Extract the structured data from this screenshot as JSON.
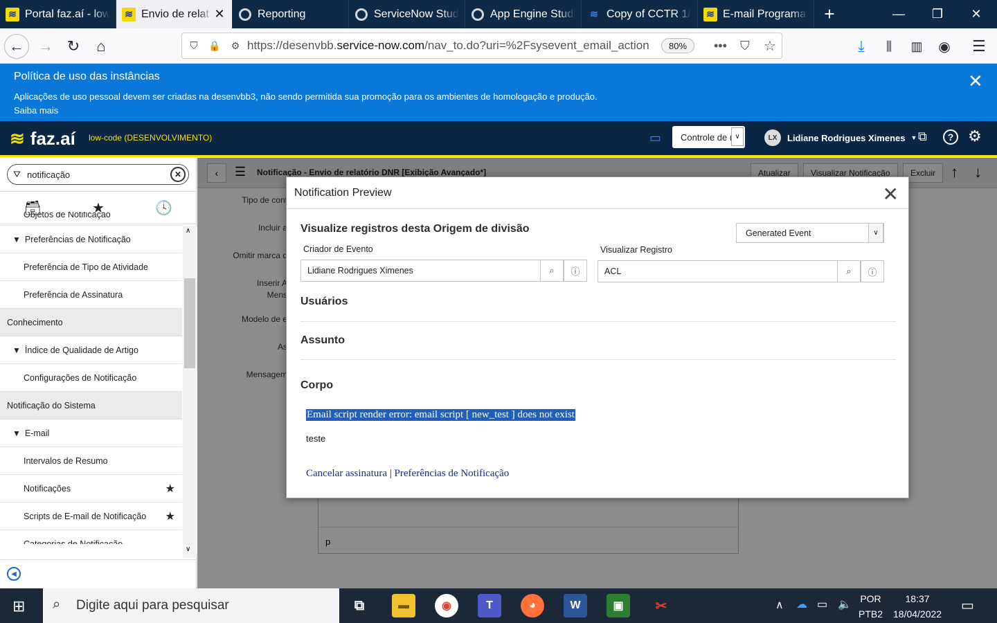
{
  "browser": {
    "tabs": [
      {
        "label": "Portal faz.aí - low",
        "icon": "faz-icon",
        "active": false
      },
      {
        "label": "Envio de relat",
        "icon": "faz-icon",
        "active": true
      },
      {
        "label": "Reporting",
        "icon": "servicenow-icon",
        "active": false
      },
      {
        "label": "ServiceNow Studi",
        "icon": "servicenow-icon",
        "active": false
      },
      {
        "label": "App Engine Studi",
        "icon": "servicenow-icon",
        "active": false
      },
      {
        "label": "Copy of CCTR 1/2",
        "icon": "bb-icon",
        "active": false
      },
      {
        "label": "E-mail Programa",
        "icon": "faz-icon",
        "active": false
      }
    ],
    "url_prefix": "https://desenvbb.",
    "url_domain": "service-now.com",
    "url_path": "/nav_to.do?uri=%2Fsysevent_email_action",
    "zoom": "80%"
  },
  "banner": {
    "title": "Política de uso das instâncias",
    "text": "Aplicações de uso pessoal devem ser criadas na desenvbb3, não sendo permitida sua promoção para os ambientes de homologação e produção.",
    "more": "Saiba mais"
  },
  "app": {
    "logo": "faz.aí",
    "subtitle": "low-code (DESENVOLVIMENTO)",
    "control_select": "Controle de (",
    "user_initials": "LX",
    "user_name": "Lidiane Rodrigues Ximenes"
  },
  "leftnav": {
    "filter": "notificação",
    "items": [
      {
        "type": "itm",
        "label": "Objetos de Notificação",
        "star": false
      },
      {
        "type": "grp",
        "label": "Preferências de Notificação",
        "star": false
      },
      {
        "type": "itm",
        "label": "Preferência de Tipo de Atividade",
        "star": false
      },
      {
        "type": "itm",
        "label": "Preferência de Assinatura",
        "star": false
      },
      {
        "type": "sec",
        "label": "Conhecimento",
        "star": false
      },
      {
        "type": "grp",
        "label": "Índice de Qualidade de Artigo",
        "star": false
      },
      {
        "type": "itm",
        "label": "Configurações de Notificação",
        "star": false
      },
      {
        "type": "sec",
        "label": "Notificação do Sistema",
        "star": false
      },
      {
        "type": "grp",
        "label": "E-mail",
        "star": false
      },
      {
        "type": "itm",
        "label": "Intervalos de Resumo",
        "star": false
      },
      {
        "type": "itm",
        "label": "Notificações",
        "star": true
      },
      {
        "type": "itm",
        "label": "Scripts de E-mail de Notificação",
        "star": true
      },
      {
        "type": "itm",
        "label": "Categorias de Notificação",
        "star": false
      }
    ]
  },
  "form": {
    "title": "Notificação - Envio de relatório DNR [Exibição Avançado*]",
    "buttons": [
      "Atualizar",
      "Visualizar Notificação",
      "Excluir"
    ],
    "labels": [
      "Tipo de cont",
      "Incluir a",
      "Omitir marca d",
      "Inserir A",
      "Mens",
      "Modelo de e",
      "As",
      "Mensagem"
    ],
    "bottom_field": "p"
  },
  "modal": {
    "title": "Notification Preview",
    "heading": "Visualize registros desta Origem de divisão",
    "event_select": "Generated Event",
    "creator_label": "Criador de Evento",
    "creator_value": "Lidiane Rodrigues Ximenes",
    "record_label": "Visualizar Registro",
    "record_value": "ACL",
    "users": "Usuários",
    "subject": "Assunto",
    "body": "Corpo",
    "error": "Email script render error: email script [ new_test ] does not exist",
    "body_text": "teste",
    "link_unsubscribe": "Cancelar assinatura",
    "link_sep": " | ",
    "link_prefs": "Preferências de Notificação"
  },
  "taskbar": {
    "search_placeholder": "Digite aqui para pesquisar",
    "lang1": "POR",
    "lang2": "PTB2",
    "time": "18:37",
    "date": "18/04/2022"
  }
}
